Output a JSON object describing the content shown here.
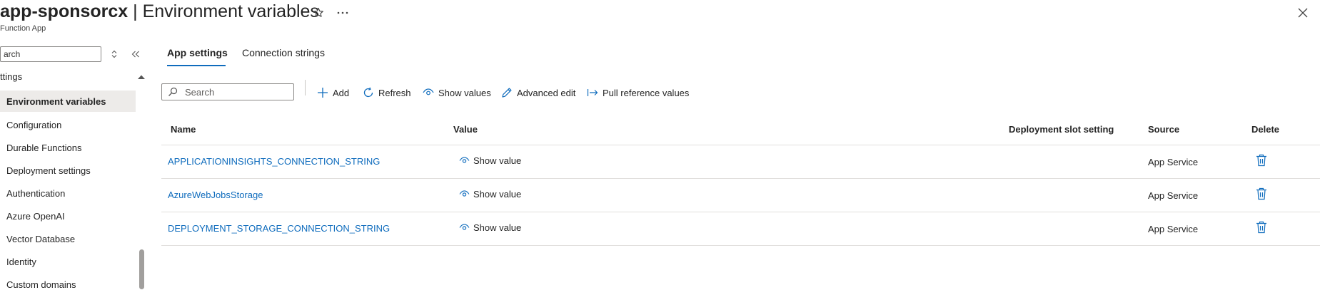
{
  "header": {
    "app_name": "app-sponsorcx",
    "separator": " | ",
    "page_title": "Environment variables",
    "subtitle": "Function App"
  },
  "sidebar": {
    "search_placeholder": "arch",
    "group_label": "ttings",
    "items": [
      {
        "label": "Environment variables",
        "active": true
      },
      {
        "label": "Configuration"
      },
      {
        "label": "Durable Functions"
      },
      {
        "label": "Deployment settings"
      },
      {
        "label": "Authentication"
      },
      {
        "label": "Azure OpenAI"
      },
      {
        "label": "Vector Database"
      },
      {
        "label": "Identity"
      },
      {
        "label": "Custom domains"
      }
    ]
  },
  "tabs": {
    "app_settings": "App settings",
    "connection_strings": "Connection strings"
  },
  "toolbar": {
    "search_placeholder": "Search",
    "add": "Add",
    "refresh": "Refresh",
    "show_values": "Show values",
    "advanced_edit": "Advanced edit",
    "pull_reference": "Pull reference values"
  },
  "table": {
    "headers": {
      "name": "Name",
      "value": "Value",
      "slot": "Deployment slot setting",
      "source": "Source",
      "delete": "Delete"
    },
    "rows": [
      {
        "name": "APPLICATIONINSIGHTS_CONNECTION_STRING",
        "value": "Show value",
        "source": "App Service"
      },
      {
        "name": "AzureWebJobsStorage",
        "value": "Show value",
        "source": "App Service"
      },
      {
        "name": "DEPLOYMENT_STORAGE_CONNECTION_STRING",
        "value": "Show value",
        "source": "App Service"
      }
    ]
  },
  "colors": {
    "accent": "#0f6cbd",
    "active_nav_bg": "#edebe9"
  }
}
